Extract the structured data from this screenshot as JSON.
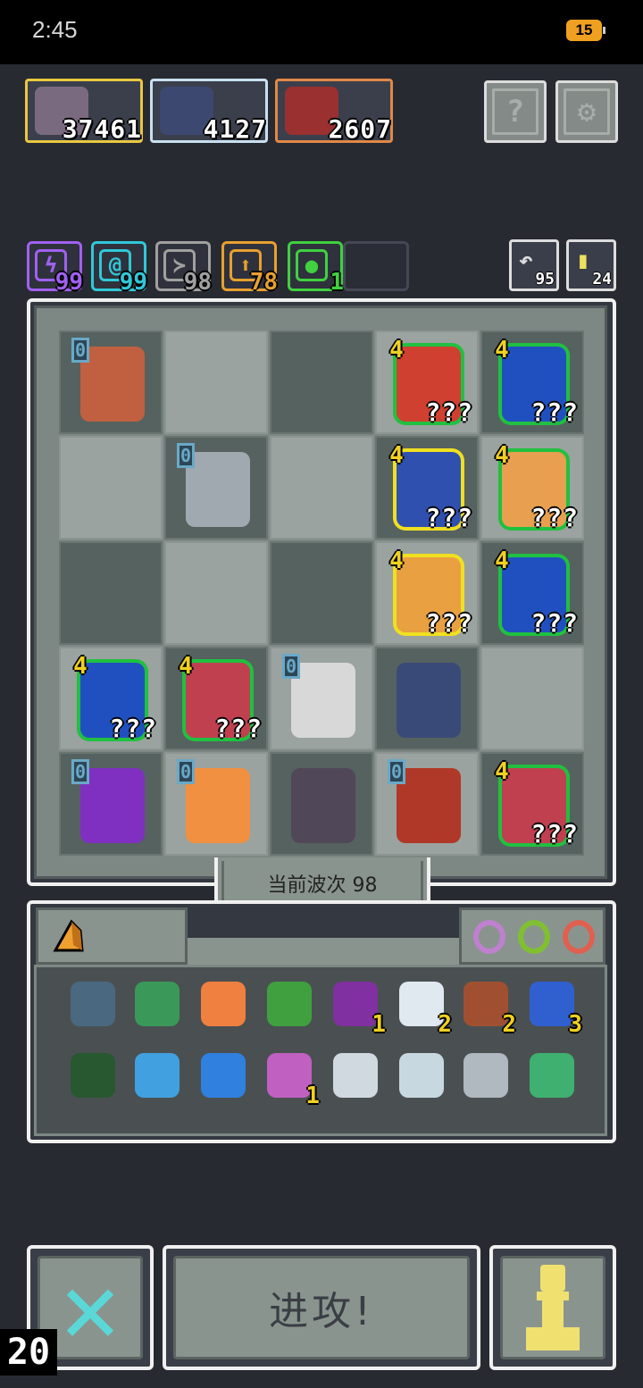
{
  "status_bar": {
    "time": "2:45",
    "battery": "15"
  },
  "bosses": [
    {
      "name": "knight-boss",
      "value": "37461",
      "border": "#e8c840",
      "color": "#7a6a80"
    },
    {
      "name": "werewolf-boss",
      "value": "4127",
      "border": "#c8e0f0",
      "color": "#3c4870"
    },
    {
      "name": "demon-boss",
      "value": "2607",
      "border": "#e08848",
      "color": "#9a3030"
    }
  ],
  "top_buttons": {
    "help": "?",
    "settings": "⚙"
  },
  "resources": [
    {
      "icon": "lightning-icon",
      "glyph": "ϟ",
      "value": "99",
      "color": "#a060f0"
    },
    {
      "icon": "swirl-icon",
      "glyph": "@",
      "value": "99",
      "color": "#30c8d8"
    },
    {
      "icon": "wing-icon",
      "glyph": "≻",
      "value": "98",
      "color": "#a0a0a0"
    },
    {
      "icon": "arrow-up-icon",
      "glyph": "⬆",
      "value": "78",
      "color": "#e8a030"
    },
    {
      "icon": "leaf-icon",
      "glyph": "●",
      "value": "1",
      "color": "#40d040"
    }
  ],
  "mini_buttons": [
    {
      "icon": "return-icon",
      "glyph": "↶",
      "value": "95",
      "color": "#ddd"
    },
    {
      "icon": "key-icon",
      "glyph": "▮",
      "value": "24",
      "color": "#f0e060"
    }
  ],
  "board": [
    [
      {
        "lv": "0",
        "kind": "demon-axe",
        "color": "#c06040"
      },
      {
        "empty": true,
        "light": true
      },
      {
        "empty": true,
        "light": false
      },
      {
        "lv": "4",
        "tag": "???",
        "kind": "elder",
        "color": "#d04030",
        "glow": "g"
      },
      {
        "lv": "4",
        "tag": "???",
        "kind": "hooded",
        "color": "#2050c0",
        "glow": "g"
      }
    ],
    [
      {
        "empty": true,
        "light": true
      },
      {
        "lv": "0",
        "kind": "knight",
        "color": "#a0a8b0"
      },
      {
        "empty": true,
        "light": true
      },
      {
        "lv": "4",
        "tag": "???",
        "kind": "mage",
        "color": "#3050b0",
        "glow": "y"
      },
      {
        "lv": "4",
        "tag": "???",
        "kind": "brute",
        "color": "#e8a050",
        "glow": "g"
      }
    ],
    [
      {
        "empty": true,
        "light": false
      },
      {
        "empty": true,
        "light": true
      },
      {
        "empty": true,
        "light": false
      },
      {
        "lv": "4",
        "tag": "???",
        "kind": "paladin",
        "color": "#e8a040",
        "glow": "y"
      },
      {
        "lv": "4",
        "tag": "???",
        "kind": "hooded",
        "color": "#2050c0",
        "glow": "g"
      }
    ],
    [
      {
        "lv": "4",
        "tag": "???",
        "kind": "hooded",
        "color": "#2050c0",
        "glow": "g"
      },
      {
        "lv": "4",
        "tag": "???",
        "kind": "silver-girl",
        "color": "#c04050",
        "glow": "g"
      },
      {
        "lv": "0",
        "kind": "monk",
        "color": "#d8d8d8"
      },
      {
        "kind": "werewolf",
        "color": "#3a4a78",
        "light": false
      },
      {
        "empty": true,
        "light": true
      }
    ],
    [
      {
        "lv": "0",
        "kind": "purple-dragon",
        "color": "#8030c0"
      },
      {
        "lv": "0",
        "kind": "cats",
        "color": "#f09040"
      },
      {
        "kind": "rock-slime",
        "color": "#504858",
        "light": false
      },
      {
        "lv": "0",
        "kind": "red-demon",
        "color": "#b03828"
      },
      {
        "lv": "4",
        "tag": "???",
        "kind": "silver-girl",
        "color": "#c04050",
        "glow": "g"
      }
    ]
  ],
  "wave": {
    "label": "当前波次 98"
  },
  "item_tabs": {
    "shard_icon": "amber-shard-icon",
    "rings": [
      {
        "icon": "purple-ring-icon",
        "color": "#c080d0"
      },
      {
        "icon": "green-ring-icon",
        "color": "#80c030"
      },
      {
        "icon": "red-ring-icon",
        "color": "#e06050"
      }
    ]
  },
  "items": [
    {
      "icon": "shield-icon",
      "color": "#4a6880",
      "count": ""
    },
    {
      "icon": "turtle-shell-icon",
      "color": "#3a9858",
      "count": ""
    },
    {
      "icon": "fire-shield-icon",
      "color": "#f08040",
      "count": ""
    },
    {
      "icon": "green-sword-icon",
      "color": "#40a040",
      "count": ""
    },
    {
      "icon": "demon-orb-icon",
      "color": "#8030a0",
      "count": "1"
    },
    {
      "icon": "wing-item-icon",
      "color": "#e0e8f0",
      "count": "2"
    },
    {
      "icon": "totem-icon",
      "color": "#a05030",
      "count": "2"
    },
    {
      "icon": "hourglass-icon",
      "color": "#3060d0",
      "count": "3"
    },
    {
      "icon": "rune-tile-icon",
      "color": "#285830",
      "count": ""
    },
    {
      "icon": "blue-claw-icon",
      "color": "#40a0e0",
      "count": ""
    },
    {
      "icon": "water-drop-icon",
      "color": "#3080e0",
      "count": ""
    },
    {
      "icon": "potion-jar-icon",
      "color": "#c060c0",
      "count": "1"
    },
    {
      "icon": "scythe-icon",
      "color": "#d0d8e0",
      "count": ""
    },
    {
      "icon": "moon-orb-icon",
      "color": "#c8d8e0",
      "count": ""
    },
    {
      "icon": "slingshot-icon",
      "color": "#b0b8c0",
      "count": ""
    },
    {
      "icon": "green-blade-icon",
      "color": "#40b070",
      "count": ""
    }
  ],
  "bottom": {
    "attack_label": "进攻!",
    "counter": "20"
  }
}
